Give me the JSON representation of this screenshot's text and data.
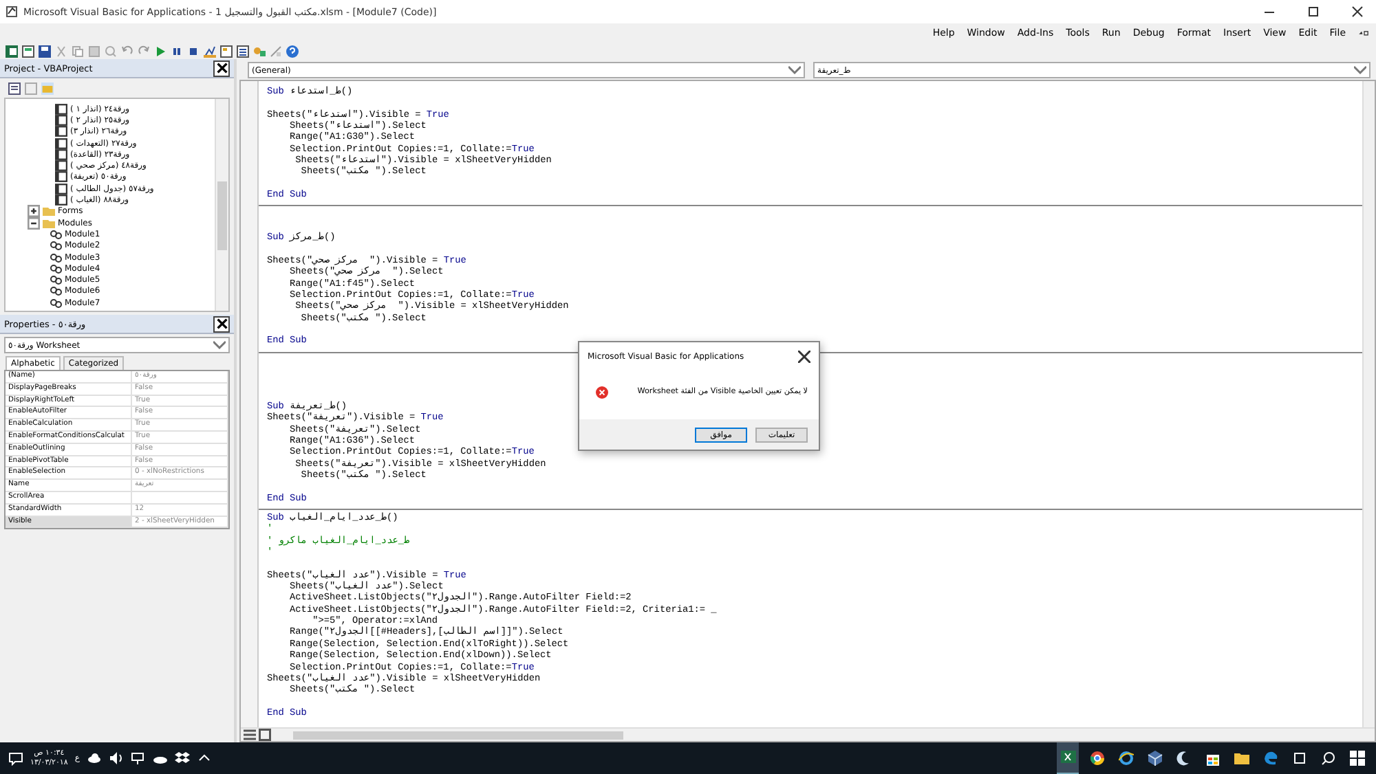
{
  "window": {
    "title": "Microsoft Visual Basic for Applications - مكتب القبول والتسجيل 1.xlsm - [Module7 (Code)]"
  },
  "menu": [
    {
      "label": "File"
    },
    {
      "label": "Edit"
    },
    {
      "label": "View"
    },
    {
      "label": "Insert"
    },
    {
      "label": "Format"
    },
    {
      "label": "Debug"
    },
    {
      "label": "Run"
    },
    {
      "label": "Tools"
    },
    {
      "label": "Add-Ins"
    },
    {
      "label": "Window"
    },
    {
      "label": "Help"
    }
  ],
  "project": {
    "title": "Project - VBAProject",
    "tree": [
      {
        "label": "ورقة٢٤ (انذار ١ )",
        "kind": "sheet"
      },
      {
        "label": "ورقة٢٥ (انذار ٢ )",
        "kind": "sheet"
      },
      {
        "label": "ورقة٢٦ (انذار ٣)",
        "kind": "sheet"
      },
      {
        "label": "ورقة٢٧ (التعهدات )",
        "kind": "sheet"
      },
      {
        "label": "ورقة٢٣ (القاعدة)",
        "kind": "sheet"
      },
      {
        "label": "ورقة٤٨ (مركز صحي )",
        "kind": "sheet"
      },
      {
        "label": "ورقة٥٠ (تعريفة)",
        "kind": "sheet"
      },
      {
        "label": "ورقة٥٧ (جدول الطالب )",
        "kind": "sheet"
      },
      {
        "label": "ورقة٨٨ (الغياب )",
        "kind": "sheet"
      },
      {
        "label": "Forms",
        "kind": "folder",
        "expanded": false
      },
      {
        "label": "Modules",
        "kind": "folder",
        "expanded": true,
        "children": [
          {
            "label": "Module1",
            "kind": "module"
          },
          {
            "label": "Module2",
            "kind": "module"
          },
          {
            "label": "Module3",
            "kind": "module"
          },
          {
            "label": "Module4",
            "kind": "module"
          },
          {
            "label": "Module5",
            "kind": "module"
          },
          {
            "label": "Module6",
            "kind": "module"
          },
          {
            "label": "Module7",
            "kind": "module"
          }
        ]
      }
    ]
  },
  "properties": {
    "title": "Properties - ورقة٥٠",
    "object": "ورقة٥٠ Worksheet",
    "tabs": [
      {
        "label": "Categorized",
        "selected": false
      },
      {
        "label": "Alphabetic",
        "selected": true
      }
    ],
    "rows": [
      {
        "name": "(Name)",
        "value": "ورقة٥٠",
        "selected": false
      },
      {
        "name": "DisplayPageBreaks",
        "value": "False",
        "selected": false
      },
      {
        "name": "DisplayRightToLeft",
        "value": "True",
        "selected": false
      },
      {
        "name": "EnableAutoFilter",
        "value": "False",
        "selected": false
      },
      {
        "name": "EnableCalculation",
        "value": "True",
        "selected": false
      },
      {
        "name": "EnableFormatConditionsCalculat",
        "value": "True",
        "selected": false
      },
      {
        "name": "EnableOutlining",
        "value": "False",
        "selected": false
      },
      {
        "name": "EnablePivotTable",
        "value": "False",
        "selected": false
      },
      {
        "name": "EnableSelection",
        "value": "0 - xlNoRestrictions",
        "selected": false
      },
      {
        "name": "Name",
        "value": "تعريفة",
        "selected": false
      },
      {
        "name": "ScrollArea",
        "selected": false
      },
      {
        "name": "StandardWidth",
        "value": "12",
        "selected": false
      },
      {
        "name": "Visible",
        "value": "2 - xlSheetVeryHidden",
        "selected": true
      }
    ]
  },
  "code": {
    "object_combo": "(General)",
    "procedure_combo": "ط_تعريفة",
    "procedures": [
      {
        "lines": [
          {
            "kind": "code",
            "keyword": "Sub",
            "text": " ط_استدعاء()"
          },
          {
            "kind": "blank"
          },
          {
            "kind": "code",
            "text": "Sheets(\"استدعاء\").Visible = ",
            "trailing_keyword": "True"
          },
          {
            "kind": "code",
            "text": "    Sheets(\"استدعاء\").Select"
          },
          {
            "kind": "code",
            "text": "    Range(\"A1:G30\").Select"
          },
          {
            "kind": "code",
            "text": "    Selection.PrintOut Copies:=1, Collate:=",
            "trailing_keyword": "True"
          },
          {
            "kind": "code",
            "text": "     Sheets(\"استدعاء\").Visible = xlSheetVeryHidden"
          },
          {
            "kind": "code",
            "text": "      Sheets(\"مكتب \").Select"
          },
          {
            "kind": "blank"
          },
          {
            "kind": "code",
            "keyword": "End Sub"
          }
        ]
      },
      {
        "lines": [
          {
            "kind": "blank"
          },
          {
            "kind": "blank"
          },
          {
            "kind": "code",
            "keyword": "Sub",
            "text": " ط_مركز()"
          },
          {
            "kind": "blank"
          },
          {
            "kind": "code",
            "text": "Sheets(\"مركز صحي  \").Visible = ",
            "trailing_keyword": "True"
          },
          {
            "kind": "code",
            "text": "    Sheets(\"مركز صحي  \").Select"
          },
          {
            "kind": "code",
            "text": "    Range(\"A1:f45\").Select"
          },
          {
            "kind": "code",
            "text": "    Selection.PrintOut Copies:=1, Collate:=",
            "trailing_keyword": "True"
          },
          {
            "kind": "code",
            "text": "     Sheets(\"مركز صحي  \").Visible = xlSheetVeryHidden"
          },
          {
            "kind": "code",
            "text": "      Sheets(\"مكتب \").Select"
          },
          {
            "kind": "blank"
          },
          {
            "kind": "code",
            "keyword": "End Sub"
          }
        ]
      },
      {
        "lines": [
          {
            "kind": "blank"
          },
          {
            "kind": "blank"
          },
          {
            "kind": "blank"
          },
          {
            "kind": "blank"
          },
          {
            "kind": "code",
            "keyword": "Sub",
            "text": " ط_تعريفة()"
          },
          {
            "kind": "code",
            "text": "Sheets(\"تعريفة\").Visible = ",
            "trailing_keyword": "True"
          },
          {
            "kind": "code",
            "text": "    Sheets(\"تعريفة\").Select"
          },
          {
            "kind": "code",
            "text": "    Range(\"A1:G36\").Select"
          },
          {
            "kind": "code",
            "text": "    Selection.PrintOut Copies:=1, Collate:=",
            "trailing_keyword": "True"
          },
          {
            "kind": "code",
            "text": "     Sheets(\"تعريفة\").Visible = xlSheetVeryHidden"
          },
          {
            "kind": "code",
            "text": "      Sheets(\"مكتب \").Select"
          },
          {
            "kind": "blank"
          },
          {
            "kind": "code",
            "keyword": "End Sub"
          }
        ]
      },
      {
        "lines": [
          {
            "kind": "code",
            "keyword": "Sub",
            "text": " ط_عدد_ايام_الغياب()"
          },
          {
            "kind": "comment",
            "text": "'"
          },
          {
            "kind": "comment",
            "text": "' ط_عدد_ايام_الغياب ماكرو"
          },
          {
            "kind": "comment",
            "text": "'"
          },
          {
            "kind": "blank"
          },
          {
            "kind": "code",
            "text": "Sheets(\"عدد الغياب\").Visible = ",
            "trailing_keyword": "True"
          },
          {
            "kind": "code",
            "text": "    Sheets(\"عدد الغياب\").Select"
          },
          {
            "kind": "code",
            "text": "    ActiveSheet.ListObjects(\"الجدول٢\").Range.AutoFilter Field:=2"
          },
          {
            "kind": "code",
            "text": "    ActiveSheet.ListObjects(\"الجدول٢\").Range.AutoFilter Field:=2, Criteria1:= _"
          },
          {
            "kind": "code",
            "text": "        \">=5\", Operator:=xlAnd"
          },
          {
            "kind": "code",
            "text": "    Range(\"الجدول٢[[#Headers],[اسم الطالب]]\").Select"
          },
          {
            "kind": "code",
            "text": "    Range(Selection, Selection.End(xlToRight)).Select"
          },
          {
            "kind": "code",
            "text": "    Range(Selection, Selection.End(xlDown)).Select"
          },
          {
            "kind": "code",
            "text": "    Selection.PrintOut Copies:=1, Collate:=",
            "trailing_keyword": "True"
          },
          {
            "kind": "code",
            "text": "Sheets(\"عدد الغياب\").Visible = xlSheetVeryHidden"
          },
          {
            "kind": "code",
            "text": "    Sheets(\"مكتب \").Select"
          },
          {
            "kind": "blank"
          },
          {
            "kind": "code",
            "keyword": "End Sub"
          }
        ]
      }
    ]
  },
  "dialog": {
    "title": "Microsoft Visual Basic for Applications",
    "message": "لا يمكن تعيين الخاصية Visible من الفئة Worksheet",
    "buttons": [
      {
        "label": "تعليمات",
        "default": false
      },
      {
        "label": "موافق",
        "default": true
      }
    ]
  },
  "taskbar": {
    "time": "١٠:٣٤ ص",
    "date": "١٣/٠٣/٢٠١٨",
    "language": "ع"
  }
}
